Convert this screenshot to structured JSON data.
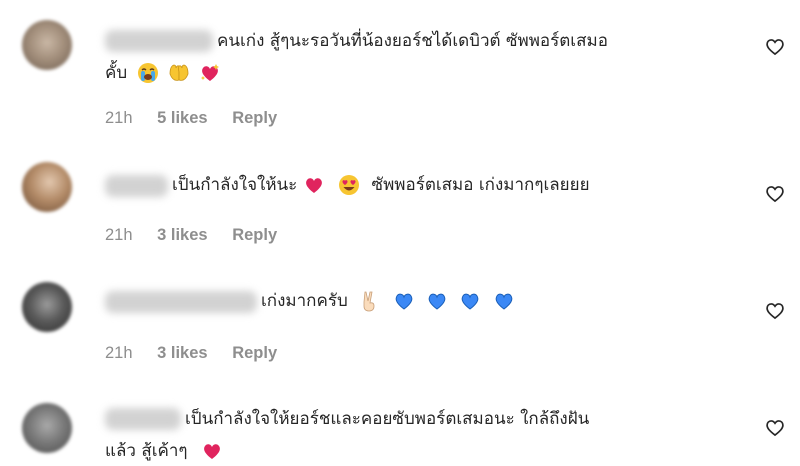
{
  "comments": [
    {
      "text": "คนเก่ง สู้ๆนะรอวันที่น้องยอร์ชได้เดบิวต์ ซัพพอร์ตเสมอ",
      "text_line2": "คั้บ",
      "emojis": [
        "crying-face",
        "raising-hands",
        "sparkling-heart"
      ],
      "time": "21h",
      "likes": "5 likes",
      "reply": "Reply"
    },
    {
      "text": "เป็นกำลังใจให้นะ",
      "text_after": "ซัพพอร์ตเสมอ เก่งมากๆเลยยย",
      "emojis": [
        "red-heart",
        "heart-eyes-face"
      ],
      "time": "21h",
      "likes": "3 likes",
      "reply": "Reply"
    },
    {
      "text": "เก่งมากครับ",
      "emojis": [
        "victory-hand",
        "blue-heart",
        "blue-heart",
        "blue-heart",
        "blue-heart"
      ],
      "time": "21h",
      "likes": "3 likes",
      "reply": "Reply"
    },
    {
      "text": "เป็นกำลังใจให้ยอร์ชและคอยซับพอร์ตเสมอนะ ใกล้ถึงฝัน",
      "text_line2": "แล้ว สู้เค้าๆ",
      "emojis": [
        "red-heart"
      ]
    }
  ],
  "colors": {
    "text": "#262626",
    "meta": "#8e8e8e",
    "red_heart": "#e0245e",
    "blue_heart": "#3b88f5"
  }
}
